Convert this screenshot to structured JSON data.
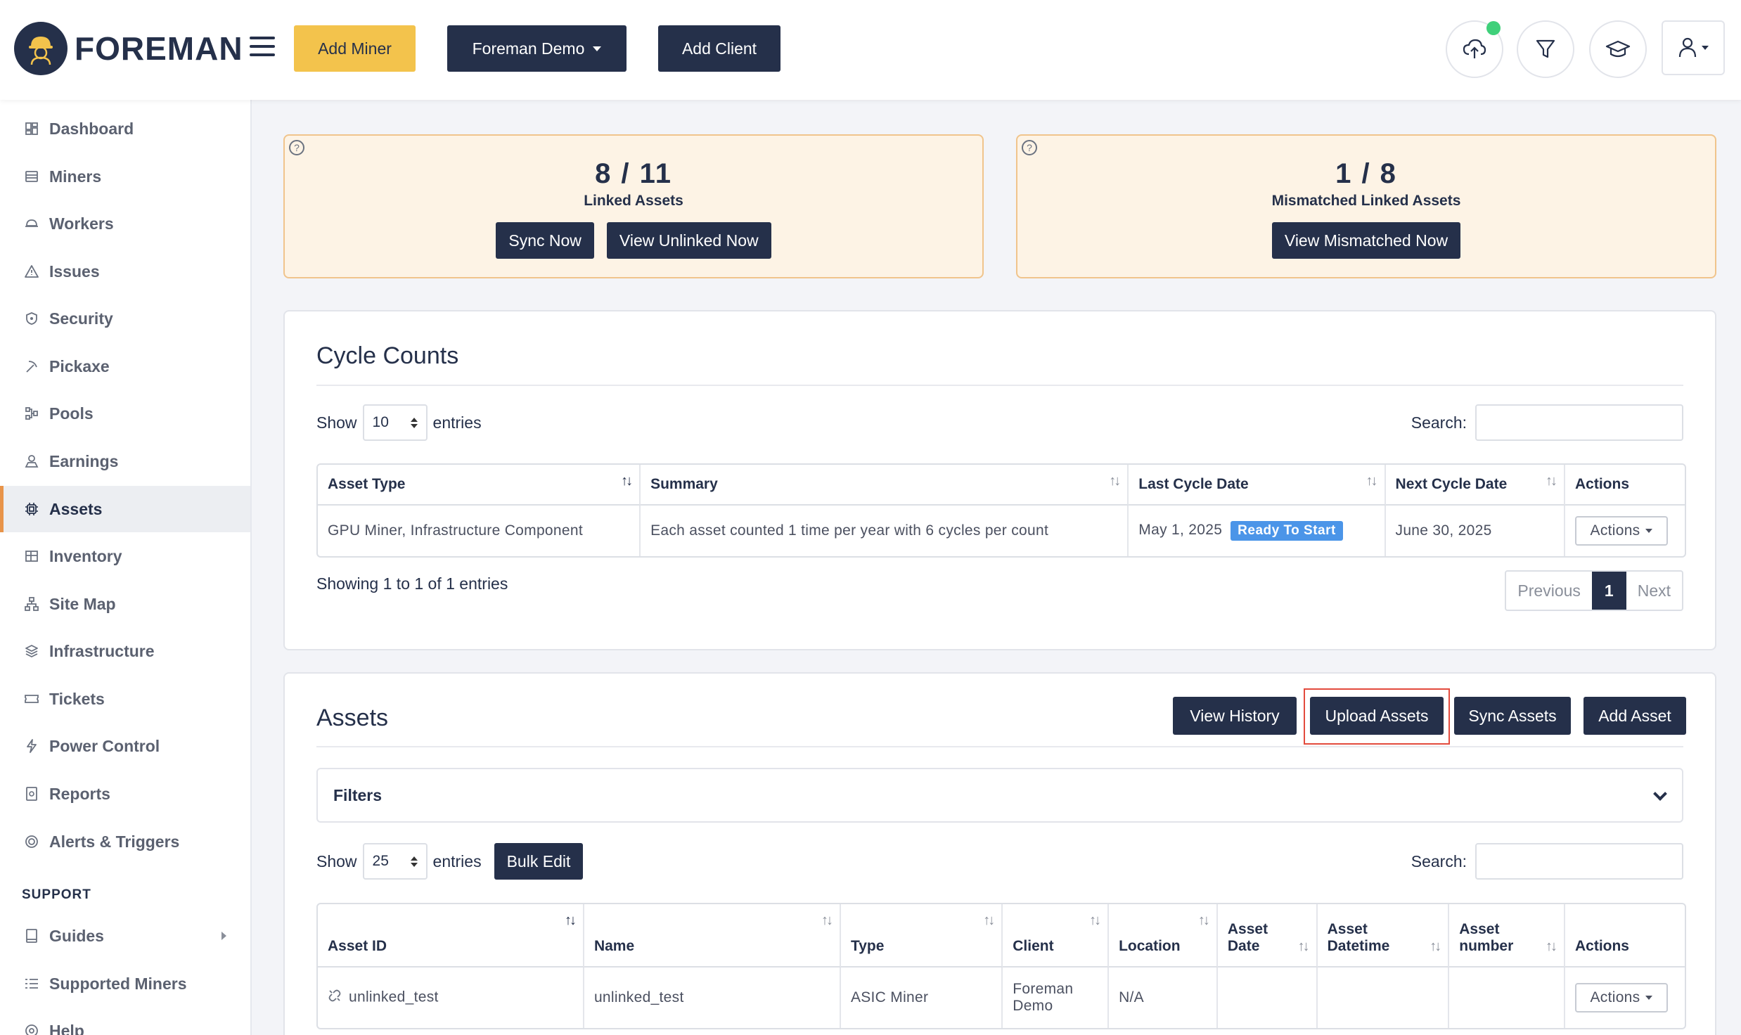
{
  "header": {
    "brand": "FOREMAN",
    "add_miner": "Add Miner",
    "org_select": "Foreman Demo",
    "add_client": "Add Client",
    "icons": [
      "upload-cloud-icon",
      "filter-icon",
      "graduation-cap-icon",
      "user-icon"
    ],
    "status_color": "#3fd07a"
  },
  "sidebar": {
    "items": [
      {
        "label": "Dashboard",
        "icon": "dashboard-icon"
      },
      {
        "label": "Miners",
        "icon": "miners-icon"
      },
      {
        "label": "Workers",
        "icon": "workers-icon"
      },
      {
        "label": "Issues",
        "icon": "warning-icon"
      },
      {
        "label": "Security",
        "icon": "shield-icon"
      },
      {
        "label": "Pickaxe",
        "icon": "pickaxe-icon"
      },
      {
        "label": "Pools",
        "icon": "pools-icon"
      },
      {
        "label": "Earnings",
        "icon": "earnings-icon"
      },
      {
        "label": "Assets",
        "icon": "assets-icon",
        "active": true
      },
      {
        "label": "Inventory",
        "icon": "inventory-icon"
      },
      {
        "label": "Site Map",
        "icon": "site-map-icon"
      },
      {
        "label": "Infrastructure",
        "icon": "layers-icon"
      },
      {
        "label": "Tickets",
        "icon": "ticket-icon"
      },
      {
        "label": "Power Control",
        "icon": "bolt-icon"
      },
      {
        "label": "Reports",
        "icon": "reports-icon"
      },
      {
        "label": "Alerts & Triggers",
        "icon": "alerts-icon"
      }
    ],
    "support_heading": "SUPPORT",
    "support_items": [
      {
        "label": "Guides",
        "icon": "guides-icon"
      },
      {
        "label": "Supported Miners",
        "icon": "list-icon"
      },
      {
        "label": "Help",
        "icon": "help-icon"
      }
    ]
  },
  "summary": {
    "linked": {
      "value": "8 / 11",
      "label": "Linked Assets",
      "sync_btn": "Sync Now",
      "view_btn": "View Unlinked Now"
    },
    "mismatched": {
      "value": "1 / 8",
      "label": "Mismatched Linked Assets",
      "view_btn": "View Mismatched Now"
    },
    "help_glyph": "?"
  },
  "cycle_counts": {
    "title": "Cycle Counts",
    "show_label": "Show",
    "entries_value": "10",
    "entries_label": "entries",
    "search_label": "Search:",
    "columns": [
      "Asset Type",
      "Summary",
      "Last Cycle Date",
      "Next Cycle Date",
      "Actions"
    ],
    "row": {
      "asset_type": "GPU Miner, Infrastructure Component",
      "summary": "Each asset counted 1 time per year with 6 cycles per count",
      "last_cycle": "May 1, 2025",
      "status": "Ready To Start",
      "next_cycle": "June 30, 2025",
      "actions": "Actions"
    },
    "showing": "Showing 1 to 1 of 1 entries",
    "pager": {
      "prev": "Previous",
      "page": "1",
      "next": "Next"
    }
  },
  "assets": {
    "title": "Assets",
    "view_history": "View History",
    "upload_assets": "Upload Assets",
    "sync_assets": "Sync Assets",
    "add_asset": "Add Asset",
    "filters": "Filters",
    "show_label": "Show",
    "entries_value": "25",
    "entries_label": "entries",
    "bulk_edit": "Bulk Edit",
    "search_label": "Search:",
    "columns": [
      {
        "l1": "Asset ID",
        "l2": ""
      },
      {
        "l1": "Name",
        "l2": ""
      },
      {
        "l1": "Type",
        "l2": ""
      },
      {
        "l1": "Client",
        "l2": ""
      },
      {
        "l1": "Location",
        "l2": ""
      },
      {
        "l1": "Asset",
        "l2": "Date"
      },
      {
        "l1": "Asset",
        "l2": "Datetime"
      },
      {
        "l1": "Asset",
        "l2": "number"
      },
      {
        "l1": "Actions",
        "l2": ""
      }
    ],
    "row": {
      "asset_id": "unlinked_test",
      "name": "unlinked_test",
      "type": "ASIC Miner",
      "client_l1": "Foreman",
      "client_l2": "Demo",
      "location": "N/A",
      "actions": "Actions"
    }
  },
  "sort_glyph": "↑↓"
}
